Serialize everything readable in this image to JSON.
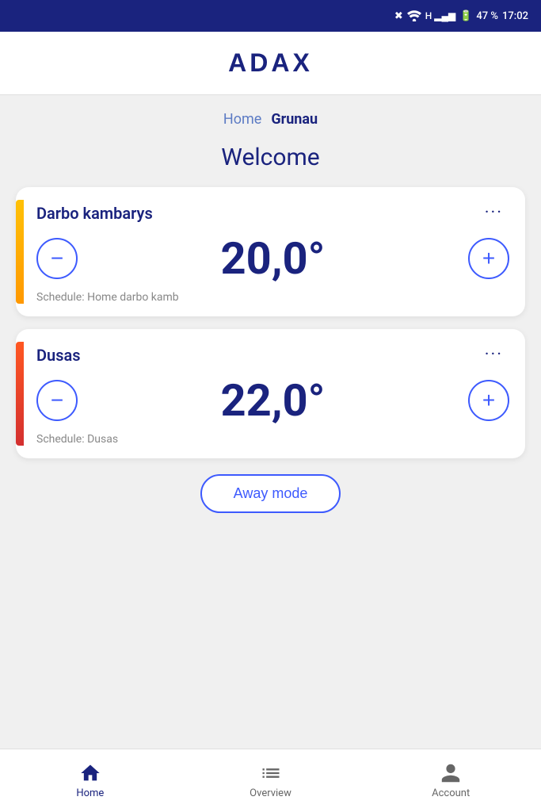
{
  "status_bar": {
    "battery": "47 %",
    "time": "17:02"
  },
  "header": {
    "logo": "ADAX"
  },
  "breadcrumb": {
    "items": [
      {
        "label": "Home",
        "active": false
      },
      {
        "label": "Grunau",
        "active": true
      }
    ]
  },
  "main": {
    "welcome": "Welcome",
    "devices": [
      {
        "name": "Darbo kambarys",
        "temperature": "20,0°",
        "schedule": "Schedule: Home darbo kamb",
        "accent": "yellow"
      },
      {
        "name": "Dusas",
        "temperature": "22,0°",
        "schedule": "Schedule: Dusas",
        "accent": "orange-red"
      }
    ],
    "away_mode_btn": "Away mode"
  },
  "bottom_nav": {
    "items": [
      {
        "label": "Home",
        "active": true
      },
      {
        "label": "Overview",
        "active": false
      },
      {
        "label": "Account",
        "active": false
      }
    ]
  }
}
